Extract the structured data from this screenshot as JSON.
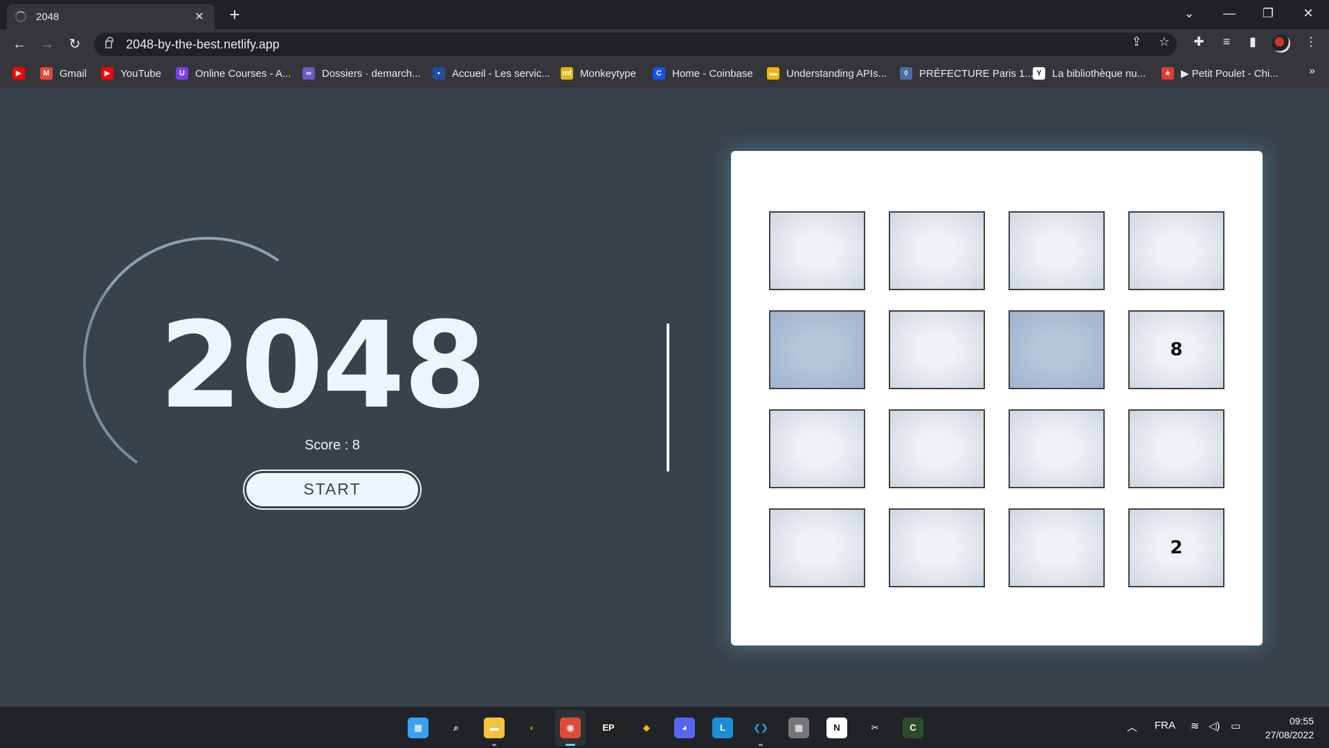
{
  "browser": {
    "tab_title": "2048",
    "tab_close": "✕",
    "new_tab": "+",
    "url": "2048-by-the-best.netlify.app",
    "bookmarks": [
      {
        "label": "",
        "color": "#ff0000",
        "glyph": "▶"
      },
      {
        "label": "Gmail",
        "color": "#ea4335",
        "glyph": "M"
      },
      {
        "label": "YouTube",
        "color": "#ff0000",
        "glyph": "▶"
      },
      {
        "label": "Online Courses - A...",
        "color": "#7b3ff2",
        "glyph": "U"
      },
      {
        "label": "Dossiers · demarch...",
        "color": "#6a5acd",
        "glyph": "∞"
      },
      {
        "label": "Accueil - Les servic...",
        "color": "#1e4fa3",
        "glyph": "▪"
      },
      {
        "label": "Monkeytype",
        "color": "#e2b714",
        "glyph": "mt"
      },
      {
        "label": "Home - Coinbase",
        "color": "#1652f0",
        "glyph": "C"
      },
      {
        "label": "Understanding APIs...",
        "color": "#f4b400",
        "glyph": "▬"
      },
      {
        "label": "PRÉFECTURE Paris 1...",
        "color": "#4a6fa5",
        "glyph": "◊"
      },
      {
        "label": "La bibliothèque nu...",
        "color": "#ffffff",
        "glyph": "Y"
      },
      {
        "label": "▶ Petit Poulet - Chi...",
        "color": "#e53935",
        "glyph": "★"
      }
    ],
    "more": "»"
  },
  "game": {
    "logo": "2048",
    "score_text": "Score : 8",
    "start_label": "START",
    "grid": [
      [
        "",
        "",
        "",
        ""
      ],
      [
        "",
        "",
        "",
        "8"
      ],
      [
        "",
        "",
        "",
        ""
      ],
      [
        "",
        "",
        "",
        "2"
      ]
    ],
    "highlighted": [
      [
        1,
        0
      ],
      [
        1,
        2
      ]
    ]
  },
  "taskbar": {
    "language": "FRA",
    "time": "09:55",
    "date": "27/08/2022",
    "apps": [
      "start-icon",
      "search-icon",
      "file-explorer-icon",
      "nvidia-icon",
      "chrome-icon",
      "epic-games-icon",
      "binance-icon",
      "discord-icon",
      "l-app-icon",
      "vscode-icon",
      "calculator-icon",
      "notion-icon",
      "snipping-tool-icon",
      "green-app-icon"
    ]
  }
}
